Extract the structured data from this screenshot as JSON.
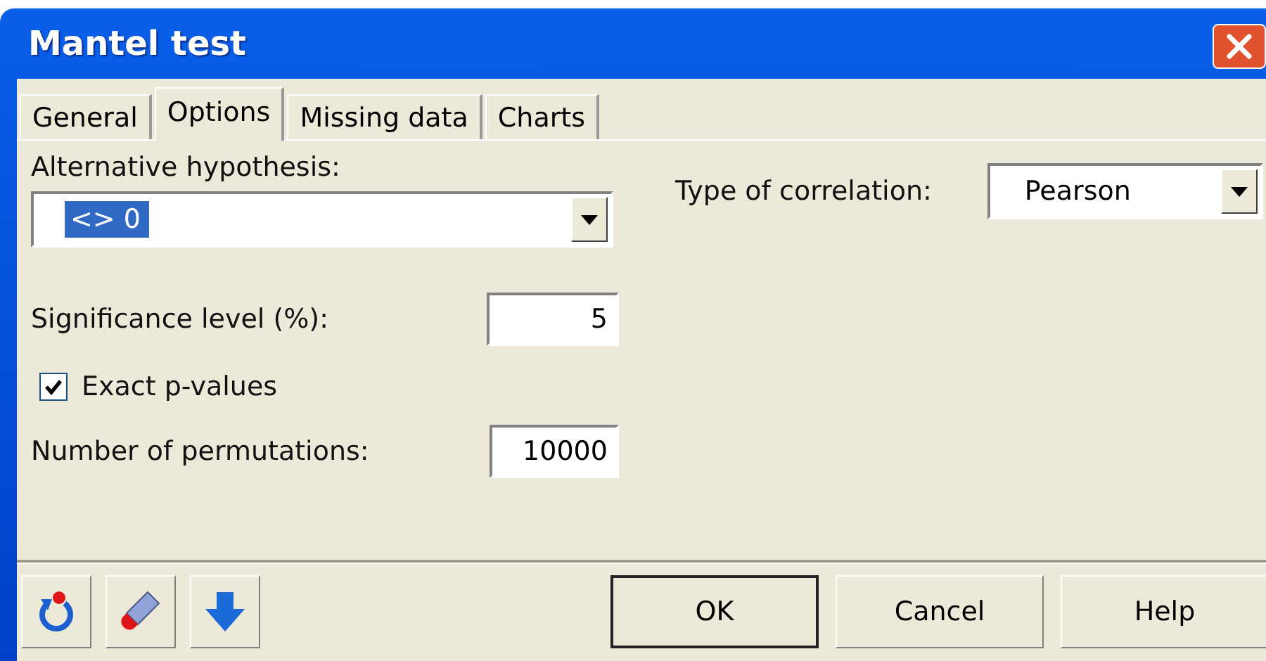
{
  "window": {
    "title": "Mantel test"
  },
  "tabs": [
    {
      "label": "General",
      "selected": false
    },
    {
      "label": "Options",
      "selected": true
    },
    {
      "label": "Missing data",
      "selected": false
    },
    {
      "label": "Charts",
      "selected": false
    }
  ],
  "alternative_hypothesis": {
    "label": "Alternative hypothesis:",
    "value": "<> 0",
    "highlighted": true
  },
  "correlation_type": {
    "label": "Type of correlation:",
    "value": "Pearson"
  },
  "significance_level": {
    "label": "Significance level (%):",
    "value": "5"
  },
  "exact_p_values": {
    "label": "Exact p-values",
    "checked": true
  },
  "permutations": {
    "label": "Number of permutations:",
    "value": "10000"
  },
  "tool_buttons": [
    {
      "kind": "reset"
    },
    {
      "kind": "eraser"
    },
    {
      "kind": "down"
    }
  ],
  "buttons": [
    {
      "label": "OK",
      "default": true
    },
    {
      "label": "Cancel",
      "default": false
    },
    {
      "label": "Help",
      "default": false
    }
  ]
}
